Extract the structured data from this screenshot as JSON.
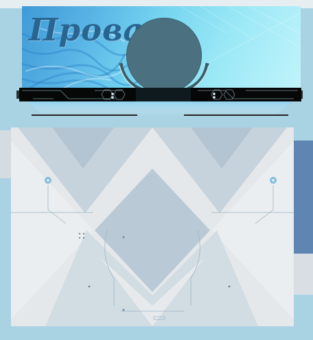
{
  "header": {
    "title": "Провал"
  },
  "colors": {
    "banner_dark": "#3f9ad7",
    "banner_light": "#c1f4fb",
    "title": "#2a6592",
    "avatar": "#4b707f",
    "bar": "#060808",
    "panel": "#e3e7ea",
    "accent": "#5aaed8"
  }
}
